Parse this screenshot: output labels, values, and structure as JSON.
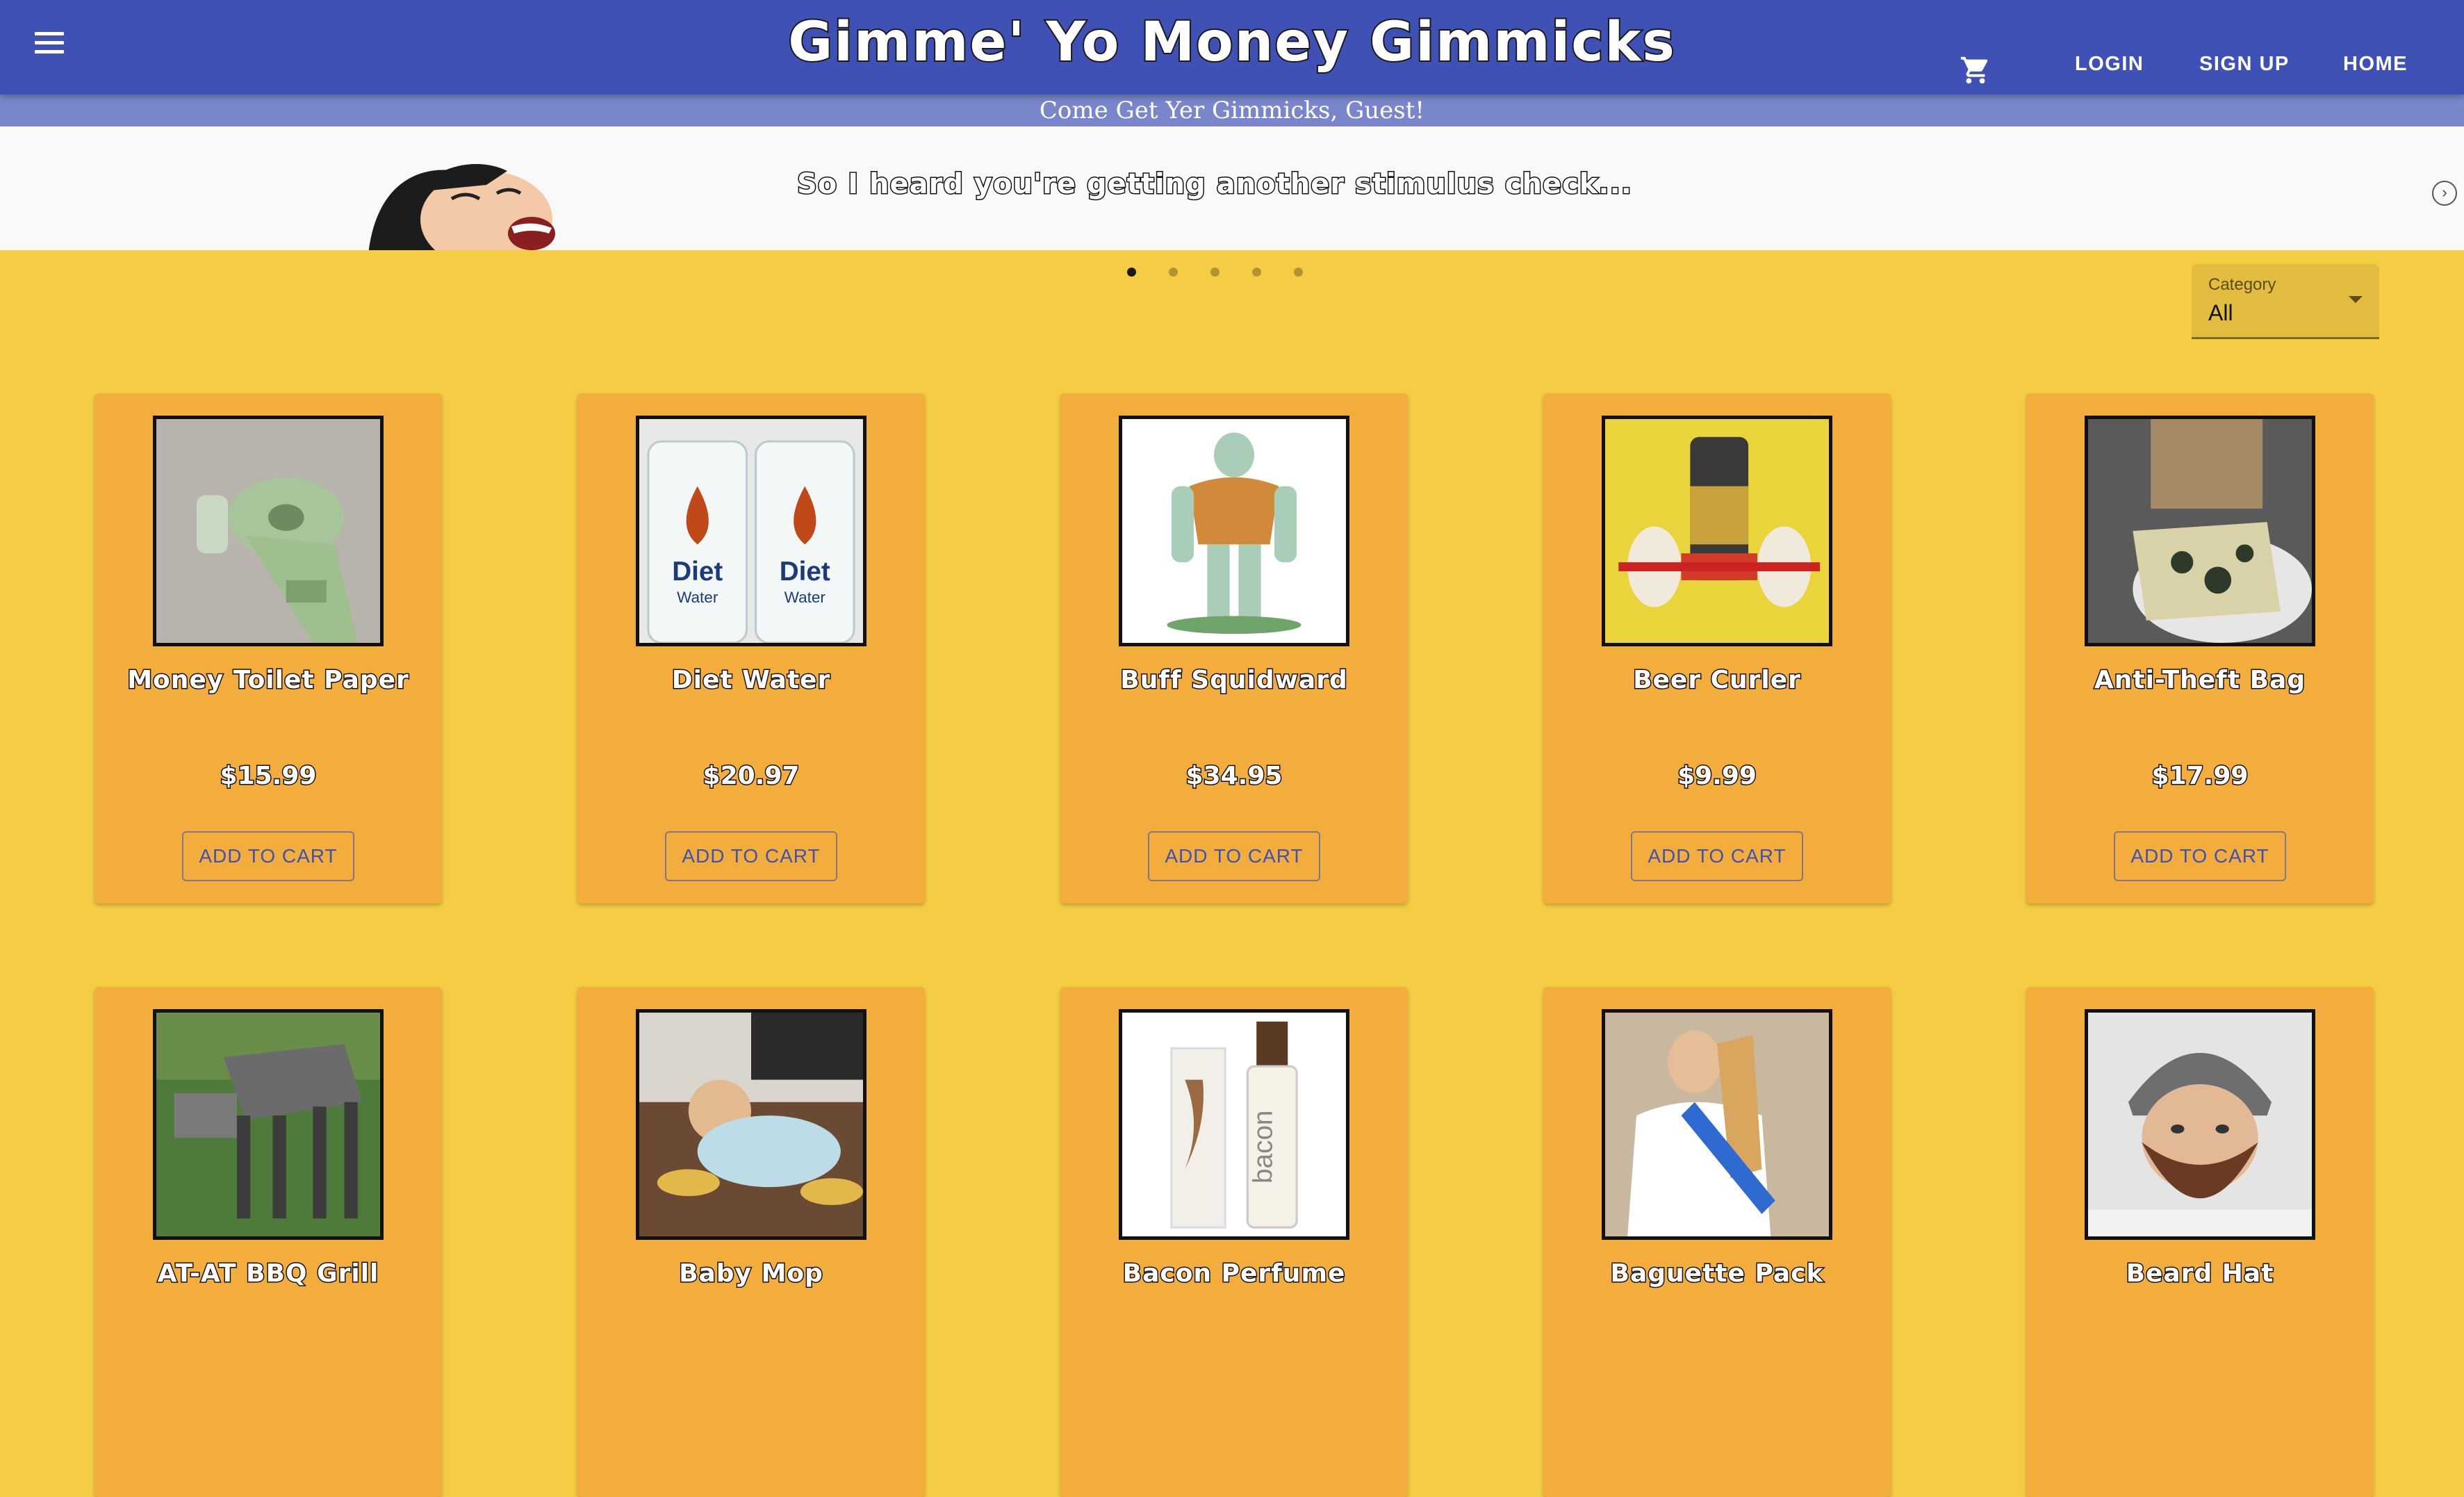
{
  "header": {
    "title": "Gimme' Yo Money Gimmicks",
    "nav": {
      "login": "LOGIN",
      "signup": "SIGN UP",
      "home": "HOME"
    },
    "subtitle": "Come Get Yer Gimmicks, Guest!",
    "icons": {
      "menu": "menu-icon",
      "cart": "shopping-cart-icon"
    }
  },
  "carousel": {
    "banner_text": "So I heard you're getting another stimulus check...",
    "slide_count": 5,
    "active_slide": 1,
    "next_icon": "chevron-right-circle-icon"
  },
  "filter": {
    "label": "Category",
    "value": "All"
  },
  "products": [
    {
      "name": "Money Toilet Paper",
      "price": "$15.99",
      "button": "ADD TO CART"
    },
    {
      "name": "Diet Water",
      "price": "$20.97",
      "button": "ADD TO CART"
    },
    {
      "name": "Buff Squidward",
      "price": "$34.95",
      "button": "ADD TO CART"
    },
    {
      "name": "Beer Curler",
      "price": "$9.99",
      "button": "ADD TO CART"
    },
    {
      "name": "Anti-Theft Bag",
      "price": "$17.99",
      "button": "ADD TO CART"
    },
    {
      "name": "AT-AT BBQ Grill"
    },
    {
      "name": "Baby Mop"
    },
    {
      "name": "Bacon Perfume"
    },
    {
      "name": "Baguette Pack"
    },
    {
      "name": "Beard Hat"
    }
  ],
  "thumb_texts": {
    "diet": "Diet",
    "water": "Water",
    "bacon": "bacon"
  },
  "colors": {
    "primary": "#3f51b5",
    "subbar": "#7986cb",
    "page_bg": "#f5cd44",
    "card_bg": "#f3ad3c"
  }
}
